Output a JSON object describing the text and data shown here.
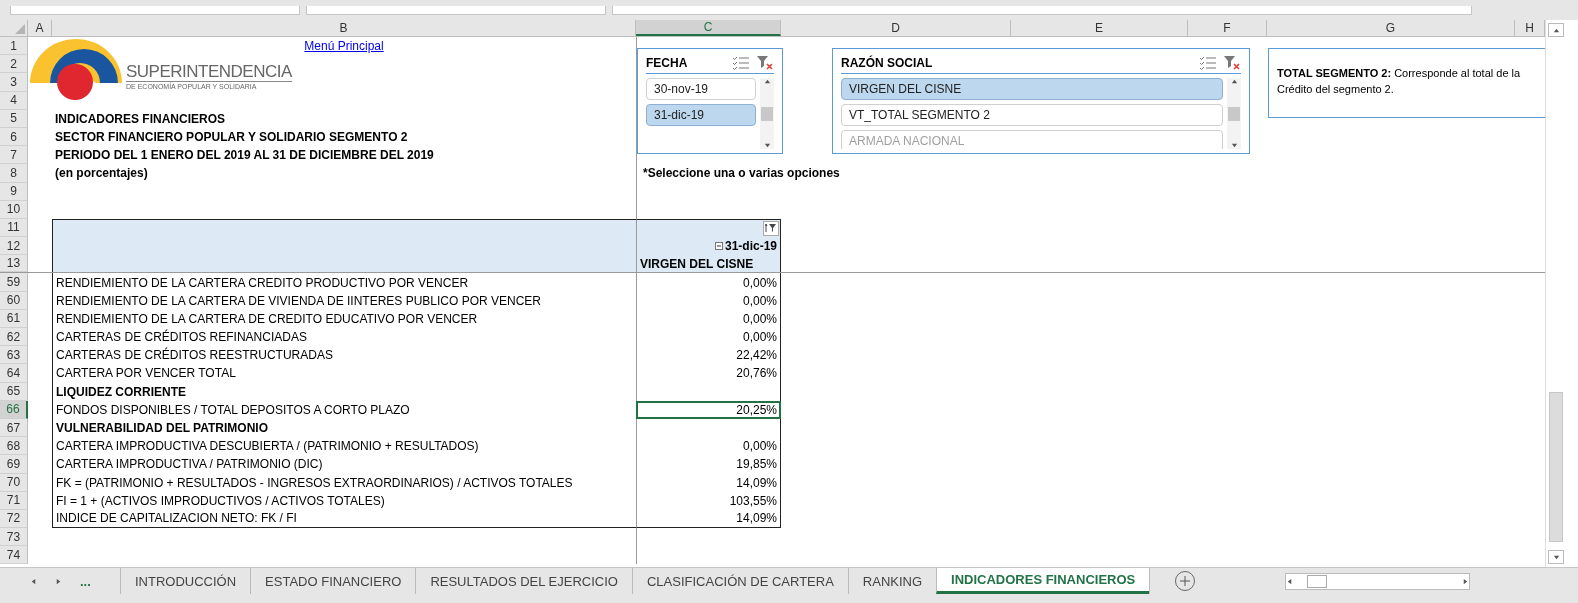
{
  "column_headers": [
    {
      "label": "A",
      "selected": false
    },
    {
      "label": "B",
      "selected": false
    },
    {
      "label": "C",
      "selected": true
    },
    {
      "label": "D",
      "selected": false
    },
    {
      "label": "E",
      "selected": false
    },
    {
      "label": "F",
      "selected": false
    },
    {
      "label": "G",
      "selected": false
    },
    {
      "label": "H",
      "selected": false
    }
  ],
  "logo": {
    "name": "SUPERINTENDENCIA",
    "subtitle": "DE ECONOMÍA POPULAR Y SOLIDARIA"
  },
  "slicers": [
    {
      "title": "FECHA",
      "items": [
        {
          "label": "30-nov-19",
          "selected": false,
          "available": true
        },
        {
          "label": "31-dic-19",
          "selected": true,
          "available": true
        }
      ]
    },
    {
      "title": "RAZÓN SOCIAL",
      "items": [
        {
          "label": "VIRGEN DEL CISNE",
          "selected": true,
          "available": true
        },
        {
          "label": "VT_TOTAL SEGMENTO 2",
          "selected": false,
          "available": true
        },
        {
          "label": "ARMADA NACIONAL",
          "selected": false,
          "available": false
        }
      ]
    }
  ],
  "text_box": {
    "lines": [
      "**TOTAL SEGMENTO 2:**  Corresponde al total de la",
      "Crédito del segmento 2."
    ]
  },
  "rows": [
    {
      "number": "1",
      "selected": false,
      "kind": "link",
      "text": "Menú Principal"
    },
    {
      "number": "2",
      "selected": false,
      "kind": "blank"
    },
    {
      "number": "3",
      "selected": false,
      "kind": "blank"
    },
    {
      "number": "4",
      "selected": false,
      "kind": "blank"
    },
    {
      "number": "5",
      "selected": false,
      "kind": "title",
      "text": "INDICADORES FINANCIEROS"
    },
    {
      "number": "6",
      "selected": false,
      "kind": "title",
      "text": "SECTOR FINANCIERO POPULAR Y SOLIDARIO SEGMENTO 2"
    },
    {
      "number": "7",
      "selected": false,
      "kind": "title",
      "text": "PERIODO DEL 1 ENERO DEL 2019 AL 31 DE DICIEMBRE DEL 2019"
    },
    {
      "number": "8",
      "selected": false,
      "kind": "title",
      "text": "(en porcentajes)",
      "note": "*Seleccione una o varias opciones"
    },
    {
      "number": "9",
      "selected": false,
      "kind": "blank"
    },
    {
      "number": "10",
      "selected": false,
      "kind": "blank"
    },
    {
      "number": "11",
      "selected": false,
      "kind": "pivot_top"
    },
    {
      "number": "12",
      "selected": false,
      "kind": "pivot_date",
      "text": "31-dic-19"
    },
    {
      "number": "13",
      "selected": false,
      "kind": "pivot_field",
      "text": "VIRGEN DEL CISNE"
    },
    {
      "number": "59",
      "selected": false,
      "kind": "data",
      "text": "RENDIEMIENTO DE LA CARTERA CREDITO PRODUCTIVO POR VENCER",
      "value": "0,00%"
    },
    {
      "number": "60",
      "selected": false,
      "kind": "data",
      "text": "RENDIEMIENTO DE LA CARTERA DE VIVIENDA DE IINTERES PUBLICO POR VENCER",
      "value": "0,00%"
    },
    {
      "number": "61",
      "selected": false,
      "kind": "data",
      "text": "RENDIEMIENTO DE LA CARTERA DE CREDITO EDUCATIVO POR VENCER",
      "value": "0,00%"
    },
    {
      "number": "62",
      "selected": false,
      "kind": "data",
      "text": "CARTERAS DE CRÉDITOS  REFINANCIADAS",
      "value": "0,00%"
    },
    {
      "number": "63",
      "selected": false,
      "kind": "data",
      "text": "CARTERAS DE CRÉDITOS  REESTRUCTURADAS",
      "value": "22,42%"
    },
    {
      "number": "64",
      "selected": false,
      "kind": "data",
      "text": "CARTERA POR VENCER TOTAL",
      "value": "20,76%"
    },
    {
      "number": "65",
      "selected": false,
      "kind": "section",
      "text": "LIQUIDEZ CORRIENTE"
    },
    {
      "number": "66",
      "selected": true,
      "kind": "data",
      "text": "FONDOS DISPONIBLES / TOTAL DEPOSITOS A CORTO PLAZO",
      "value": "20,25%"
    },
    {
      "number": "67",
      "selected": false,
      "kind": "section",
      "text": "VULNERABILIDAD DEL PATRIMONIO"
    },
    {
      "number": "68",
      "selected": false,
      "kind": "data",
      "text": "CARTERA IMPRODUCTIVA DESCUBIERTA / (PATRIMONIO + RESULTADOS)",
      "value": "0,00%"
    },
    {
      "number": "69",
      "selected": false,
      "kind": "data",
      "text": "CARTERA IMPRODUCTIVA / PATRIMONIO (DIC)",
      "value": "19,85%"
    },
    {
      "number": "70",
      "selected": false,
      "kind": "data",
      "text": "FK = (PATRIMONIO + RESULTADOS - INGRESOS EXTRAORDINARIOS) / ACTIVOS TOTALES",
      "value": "14,09%"
    },
    {
      "number": "71",
      "selected": false,
      "kind": "data",
      "text": "FI = 1 + (ACTIVOS IMPRODUCTIVOS / ACTIVOS TOTALES)",
      "value": "103,55%"
    },
    {
      "number": "72",
      "selected": false,
      "kind": "data",
      "text": "INDICE DE CAPITALIZACION NETO: FK / FI",
      "value": "14,09%"
    },
    {
      "number": "73",
      "selected": false,
      "kind": "blank"
    },
    {
      "number": "74",
      "selected": false,
      "kind": "blank"
    }
  ],
  "sheet_tabs": {
    "overflow": "...",
    "tabs": [
      {
        "label": "INTRODUCCIÓN",
        "selected": false
      },
      {
        "label": "ESTADO FINANCIERO",
        "selected": false
      },
      {
        "label": "RESULTADOS DEL EJERCICIO",
        "selected": false
      },
      {
        "label": "CLASIFICACIÓN DE CARTERA",
        "selected": false
      },
      {
        "label": "RANKING",
        "selected": false
      },
      {
        "label": "INDICADORES FINANCIEROS",
        "selected": true
      }
    ]
  }
}
